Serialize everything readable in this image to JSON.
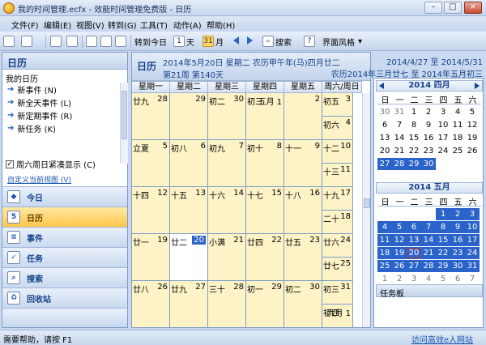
{
  "window": {
    "title": "我的时间管理.ecfx - 效能时间管理免费版 - 日历",
    "minimize": "–",
    "maximize": "□",
    "close": "×"
  },
  "menubar": {
    "items": [
      "文件(F)",
      "编辑(E)",
      "视图(V)",
      "转到(G)",
      "工具(T)",
      "动作(A)",
      "帮助(H)"
    ]
  },
  "toolbar": {
    "today_label": "转到今日",
    "day_label": "天",
    "day_icon_text": "1",
    "month_label": "月",
    "month_icon_text": "31",
    "search_label": "搜索",
    "help_icon_text": "?",
    "theme_label": "界面风格"
  },
  "navigation": {
    "header": "日历",
    "sub_title": "我的日历",
    "links": [
      "新事件 (N)",
      "新全天事件 (L)",
      "新定期事件 (R)",
      "新任务 (K)"
    ],
    "weekend_compact_checked": "✓",
    "weekend_compact_label": "周六周日紧凑显示 (C)",
    "customize_label": "自定义当前视图 (V)",
    "buttons": [
      {
        "label": "今日",
        "icon_text": "◆"
      },
      {
        "label": "日历",
        "icon_text": "5"
      },
      {
        "label": "事件",
        "icon_text": "≡"
      },
      {
        "label": "任务",
        "icon_text": "✓"
      },
      {
        "label": "搜索",
        "icon_text": "⌕"
      },
      {
        "label": "回收站",
        "icon_text": "♻"
      }
    ]
  },
  "calendar": {
    "title": "日历",
    "date_line": "2014年5月20日 星期二 农历甲午年(马)四月廿二",
    "range_line": "2014/4/27 至 2014/5/31",
    "week_line": "第21周 第140天",
    "lunar_range": "农历2014年三月廿七 至 2014年五月初三",
    "weekdays": [
      "星期一",
      "星期二",
      "星期三",
      "星期四",
      "星期五",
      "周六/周日"
    ],
    "weeks": [
      {
        "days": [
          {
            "label": "廿九",
            "num": "28"
          },
          {
            "label": "",
            "num": "29"
          },
          {
            "label": "初二",
            "num": "30"
          },
          {
            "label": "初三",
            "num": "五月 1"
          },
          {
            "label": "",
            "num": "2"
          }
        ],
        "sat": {
          "label": "初五",
          "num": "3"
        },
        "sun": {
          "label": "初六",
          "num": "4"
        }
      },
      {
        "days": [
          {
            "label": "立夏",
            "num": "5"
          },
          {
            "label": "初八",
            "num": "6"
          },
          {
            "label": "初九",
            "num": "7"
          },
          {
            "label": "初十",
            "num": "8"
          },
          {
            "label": "十一",
            "num": "9"
          }
        ],
        "sat": {
          "label": "十二",
          "num": "10"
        },
        "sun": {
          "label": "十三",
          "num": "11"
        }
      },
      {
        "days": [
          {
            "label": "十四",
            "num": "12"
          },
          {
            "label": "十五",
            "num": "13"
          },
          {
            "label": "十六",
            "num": "14"
          },
          {
            "label": "十七",
            "num": "15"
          },
          {
            "label": "十八",
            "num": "16"
          }
        ],
        "sat": {
          "label": "十九",
          "num": "17"
        },
        "sun": {
          "label": "二十",
          "num": "18"
        }
      },
      {
        "days": [
          {
            "label": "廿一",
            "num": "19"
          },
          {
            "label": "廿二",
            "num": "20"
          },
          {
            "label": "小满",
            "num": "21"
          },
          {
            "label": "廿四",
            "num": "22"
          },
          {
            "label": "廿五",
            "num": "23"
          }
        ],
        "sat": {
          "label": "廿六",
          "num": "24"
        },
        "sun": {
          "label": "廿七",
          "num": "25"
        }
      },
      {
        "days": [
          {
            "label": "廿八",
            "num": "26"
          },
          {
            "label": "廿九",
            "num": "27"
          },
          {
            "label": "三十",
            "num": "28"
          },
          {
            "label": "初一",
            "num": "29"
          },
          {
            "label": "初二",
            "num": "30"
          }
        ],
        "sat": {
          "label": "初三",
          "num": "31"
        },
        "sun": {
          "label": "初四",
          "num": "六月 1"
        }
      }
    ],
    "today": "20"
  },
  "mini_calendars": {
    "weekday_headers": [
      "日",
      "一",
      "二",
      "三",
      "四",
      "五",
      "六"
    ],
    "april": {
      "title": "2014 四月",
      "rows": [
        [
          "30",
          "31",
          "1",
          "2",
          "3",
          "4",
          "5"
        ],
        [
          "6",
          "7",
          "8",
          "9",
          "10",
          "11",
          "12"
        ],
        [
          "13",
          "14",
          "15",
          "16",
          "17",
          "18",
          "19"
        ],
        [
          "20",
          "21",
          "22",
          "23",
          "24",
          "25",
          "26"
        ],
        [
          "27",
          "28",
          "29",
          "30",
          "",
          "",
          ""
        ]
      ]
    },
    "may": {
      "title": "2014 五月",
      "rows": [
        [
          "",
          "",
          "",
          "",
          "1",
          "2",
          "3"
        ],
        [
          "4",
          "5",
          "6",
          "7",
          "8",
          "9",
          "10"
        ],
        [
          "11",
          "12",
          "13",
          "14",
          "15",
          "16",
          "17"
        ],
        [
          "18",
          "19",
          "20",
          "21",
          "22",
          "23",
          "24"
        ],
        [
          "25",
          "26",
          "27",
          "28",
          "29",
          "30",
          "31"
        ],
        [
          "1",
          "2",
          "3",
          "4",
          "5",
          "6",
          "7"
        ]
      ]
    },
    "task_header": "任务板"
  },
  "statusbar": {
    "help_text": "需要帮助，请按 F1",
    "site_link": "访问高效e人网站"
  }
}
